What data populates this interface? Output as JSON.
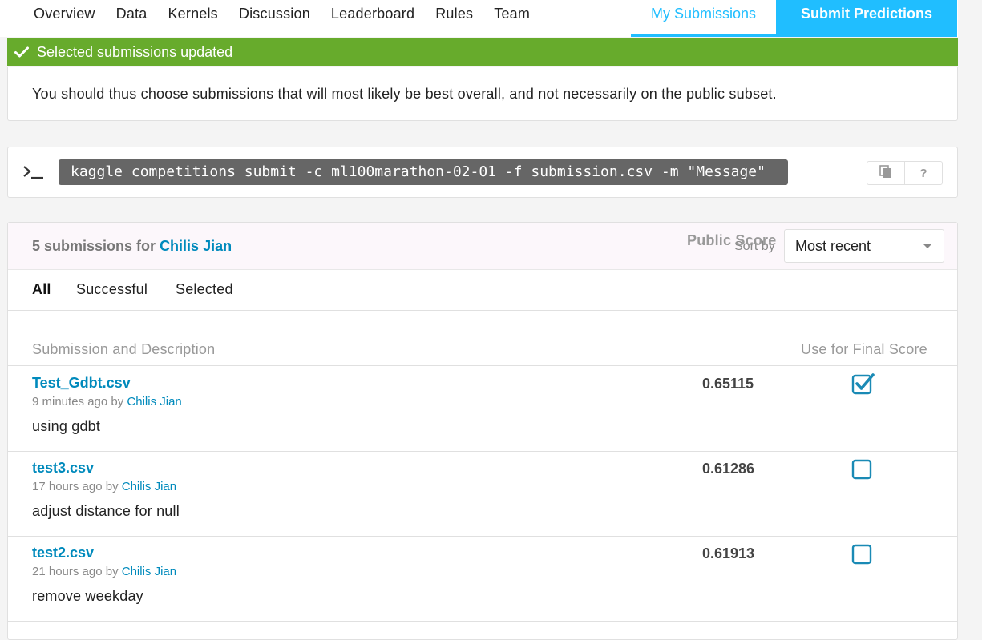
{
  "nav": {
    "tabs": [
      "Overview",
      "Data",
      "Kernels",
      "Discussion",
      "Leaderboard",
      "Rules",
      "Team"
    ],
    "my_submissions": "My Submissions",
    "submit_predictions": "Submit Predictions"
  },
  "alert": {
    "message": "Selected submissions updated",
    "icon": "check-icon",
    "color": "#67ab2c"
  },
  "info": {
    "text": "You should thus choose submissions that will most likely be best overall, and not necessarily on the public subset."
  },
  "cli": {
    "command": "kaggle competitions submit -c ml100marathon-02-01 -f submission.csv -m \"Message\"",
    "help_label": "?"
  },
  "submissions": {
    "count_prefix": "5 submissions for",
    "user": "Chilis Jian",
    "sort_label": "Sort by",
    "sort_value": "Most recent",
    "filters": [
      "All",
      "Successful",
      "Selected"
    ],
    "active_filter": "All",
    "columns": {
      "description": "Submission and Description",
      "public_score": "Public Score",
      "final": "Use for Final Score"
    },
    "rows": [
      {
        "file": "Test_Gdbt.csv",
        "time": "9 minutes ago by",
        "by": "Chilis Jian",
        "description": "using gdbt",
        "score": "0.65115",
        "selected": true
      },
      {
        "file": "test3.csv",
        "time": "17 hours ago by",
        "by": "Chilis Jian",
        "description": "adjust distance for null",
        "score": "0.61286",
        "selected": false
      },
      {
        "file": "test2.csv",
        "time": "21 hours ago by",
        "by": "Chilis Jian",
        "description": "remove weekday",
        "score": "0.61913",
        "selected": false
      }
    ]
  },
  "colors": {
    "accent": "#20beff",
    "link": "#008abc",
    "checkbox": "#1a8ab5"
  }
}
